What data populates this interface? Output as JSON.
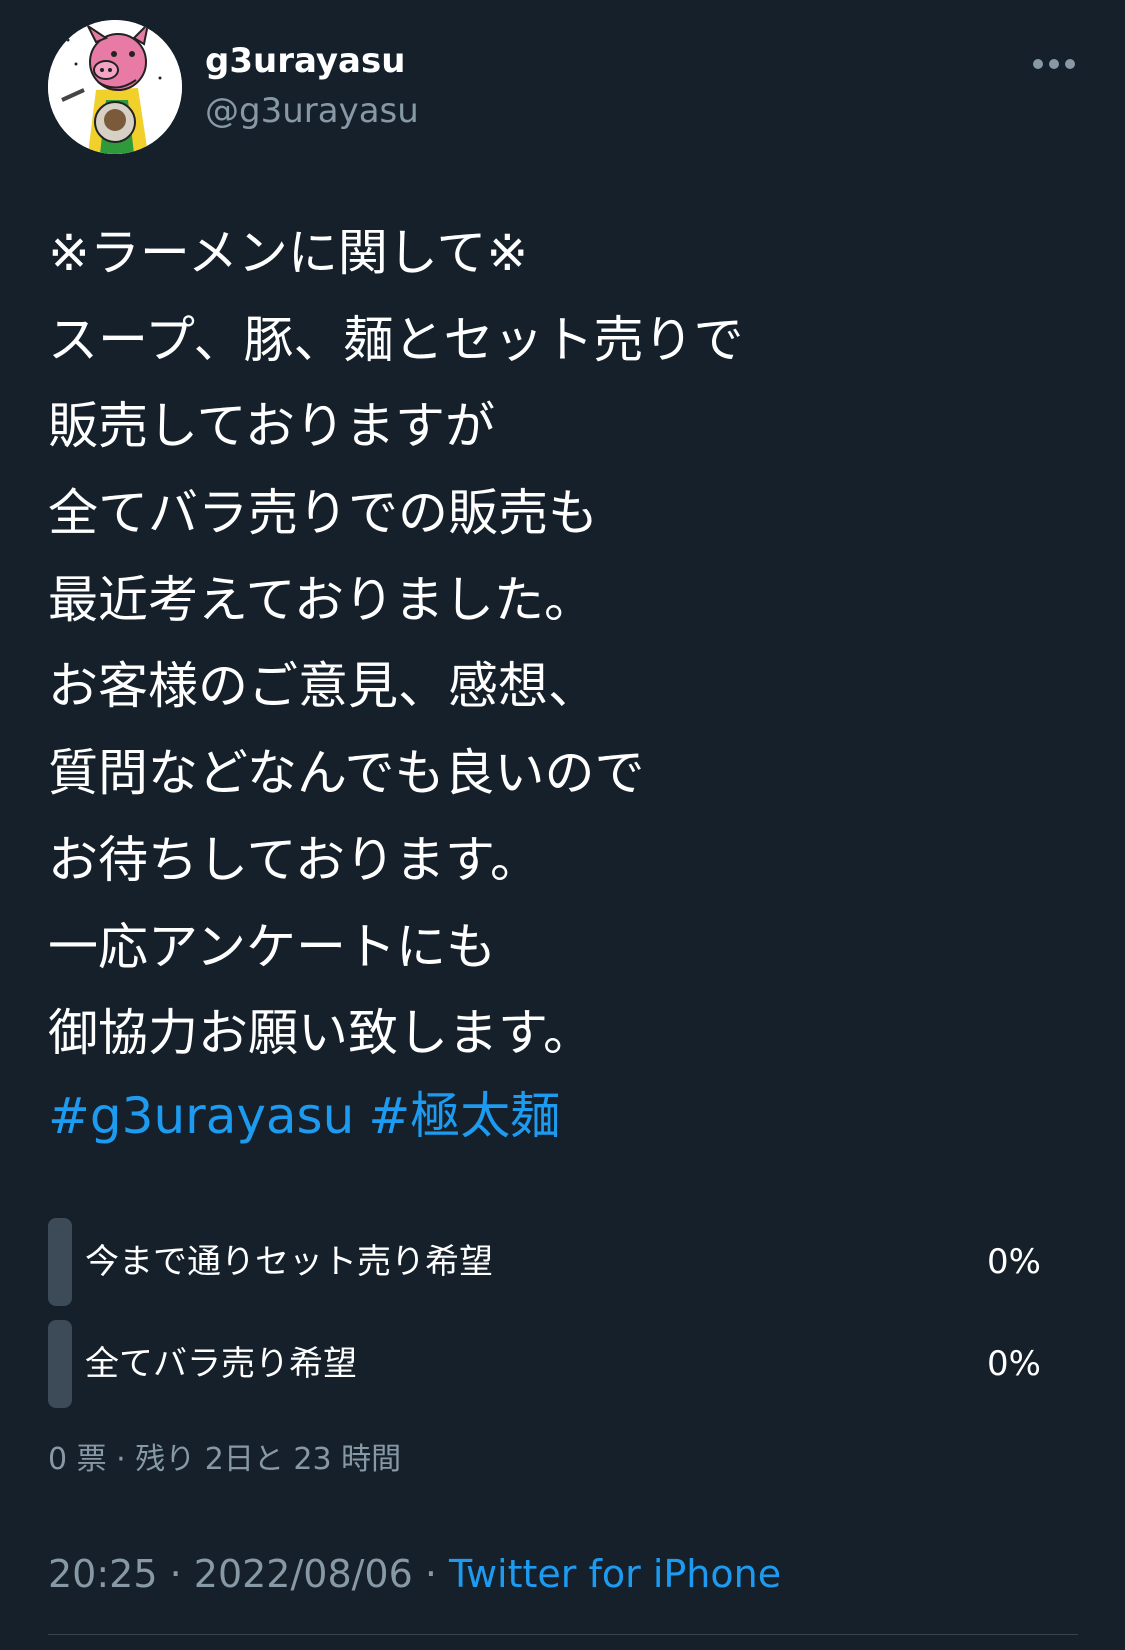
{
  "user": {
    "display_name": "g3urayasu",
    "handle": "@g3urayasu",
    "avatar_icon": "pig-chef-ramen-illustration",
    "more_icon": "more-horizontal-icon"
  },
  "tweet": {
    "lines": [
      "※ラーメンに関して※",
      "スープ、豚、麺とセット売りで",
      "販売しておりますが",
      "全てバラ売りでの販売も",
      "最近考えておりました。",
      "お客様のご意見、感想、",
      "質問などなんでも良いので",
      "お待ちしております。",
      "一応アンケートにも",
      "御協力お願い致します。"
    ],
    "hashtags": [
      "#g3urayasu",
      "#極太麺"
    ]
  },
  "poll": {
    "options": [
      {
        "label": "今まで通りセット売り希望",
        "percent": "0%",
        "fraction": 0
      },
      {
        "label": "全てバラ売り希望",
        "percent": "0%",
        "fraction": 0
      }
    ],
    "meta": "0 票 · 残り 2日と 23 時間"
  },
  "footer": {
    "time": "20:25",
    "separator": " · ",
    "date": "2022/08/06",
    "source": "Twitter for iPhone"
  },
  "colors": {
    "background": "#15202b",
    "text": "#ffffff",
    "secondary": "#8899a6",
    "link": "#1d9bf0",
    "poll_bar": "#3d4b59"
  }
}
